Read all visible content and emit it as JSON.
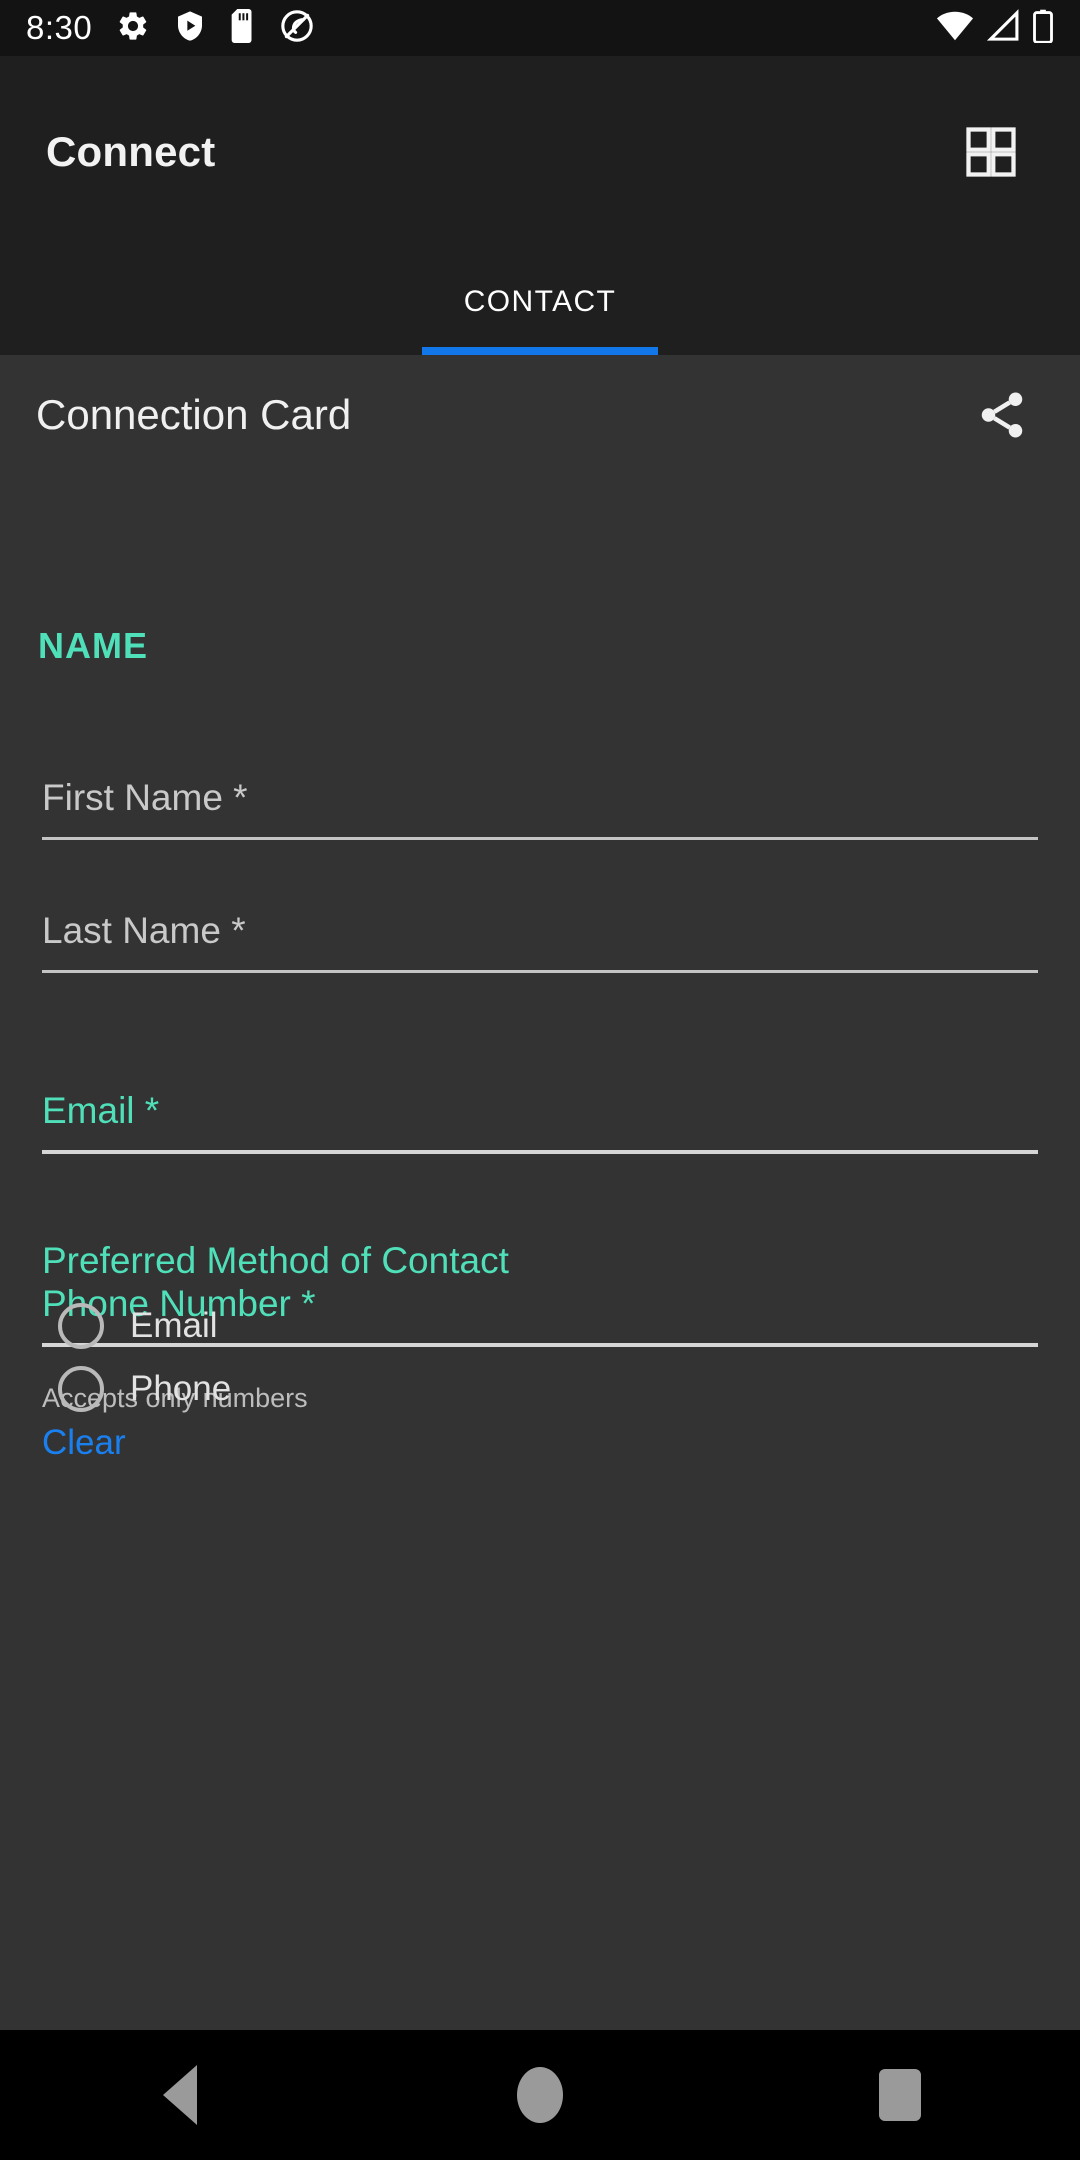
{
  "status_bar": {
    "time": "8:30",
    "left_icons": [
      "gear-icon",
      "play-protect-shield-icon",
      "sd-card-icon",
      "no-sync-circle-icon"
    ],
    "right_icons": [
      "wifi-icon",
      "cell-signal-icon",
      "battery-icon"
    ]
  },
  "app_bar": {
    "title": "Connect",
    "action_icon": "grid-view-icon"
  },
  "tabs": [
    {
      "label": "CONTACT",
      "selected": true
    }
  ],
  "card": {
    "title": "Connection Card",
    "action_icon": "share-icon"
  },
  "form": {
    "section_label": "NAME",
    "fields": [
      {
        "label": "First Name *",
        "value": "",
        "accent": false
      },
      {
        "label": "Last Name *",
        "value": "",
        "accent": false
      },
      {
        "label": "Email *",
        "value": "",
        "accent": true
      },
      {
        "label": "Phone Number *",
        "value": "",
        "accent": true
      }
    ],
    "phone_helper": "Accepts only numbers",
    "radio_group": {
      "label": "Preferred Method of Contact",
      "options": [
        {
          "label": "Email",
          "selected": false
        },
        {
          "label": "Phone",
          "selected": false
        }
      ],
      "clear_label": "Clear"
    }
  },
  "nav_bar": {
    "back": "back-icon",
    "home": "home-icon",
    "recents": "recents-icon"
  },
  "colors": {
    "accent_teal": "#4fe0ba",
    "tab_indicator_blue": "#1277e8",
    "link_blue": "#1a80f0",
    "app_bar_bg": "#1f1f1f",
    "content_bg": "#333333",
    "status_bar_bg": "#131313"
  }
}
